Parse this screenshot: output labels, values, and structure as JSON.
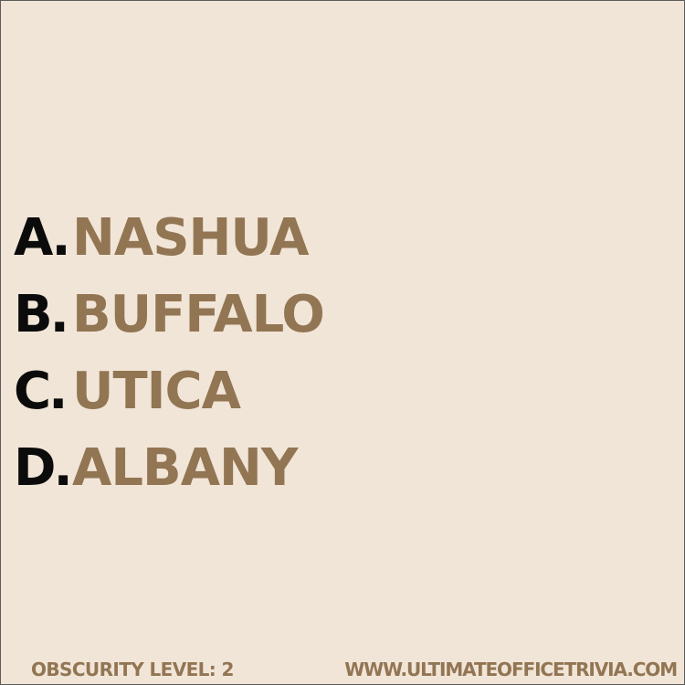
{
  "options": [
    {
      "letter": "A.",
      "answer": "NASHUA"
    },
    {
      "letter": "B.",
      "answer": "BUFFALO"
    },
    {
      "letter": "C.",
      "answer": "UTICA"
    },
    {
      "letter": "D.",
      "answer": "ALBANY"
    }
  ],
  "footer": {
    "obscurity": "OBSCURITY LEVEL: 2",
    "website": "WWW.ULTIMATEOFFICETRIVIA.COM"
  },
  "colors": {
    "background": "#f1e5d7",
    "letter": "#0b0b0b",
    "answer": "#927553"
  }
}
